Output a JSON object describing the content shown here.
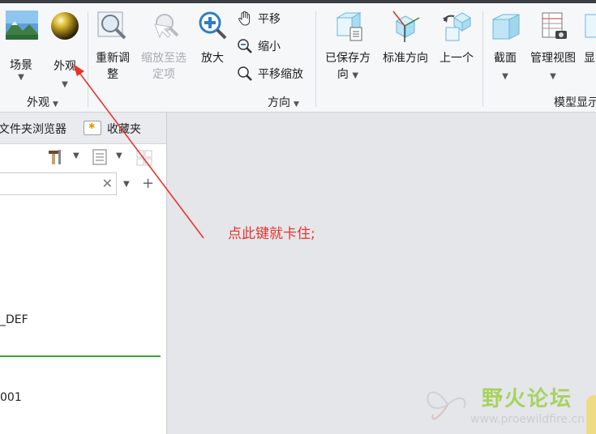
{
  "ribbon": {
    "groups": {
      "appearance_label": "外观",
      "orientation_label": "方向",
      "model_display_label": "模型显示"
    },
    "buttons": {
      "scene": "场景",
      "appearance": "外观",
      "refit": "重新调\n整",
      "refit_line1": "重新调",
      "refit_line2": "整",
      "zoom_to_selected_line1": "缩放至选",
      "zoom_to_selected_line2": "定项",
      "zoom_in": "放大",
      "pan": "平移",
      "zoom_out": "缩小",
      "pan_zoom": "平移缩放",
      "saved_orientations_line1": "已保存方",
      "saved_orientations_line2": "向",
      "standard_orientation": "标准方向",
      "previous": "上一个",
      "section": "截面",
      "manage_views": "管理视图",
      "display_partial": "显"
    }
  },
  "left_panel": {
    "tabs": {
      "folder_browser": "文件夹浏览器",
      "favorites": "收藏夹"
    },
    "tree": {
      "item_def": "_DEF",
      "item_001": "001"
    }
  },
  "annotation": {
    "text": "点此键就卡住;"
  },
  "watermark": {
    "title": "野火论坛",
    "url": "www.proewildfire.cn"
  },
  "colors": {
    "annotation_red": "#e8332b",
    "tree_green": "#3aa335",
    "watermark_text": "#9ccf4a"
  }
}
